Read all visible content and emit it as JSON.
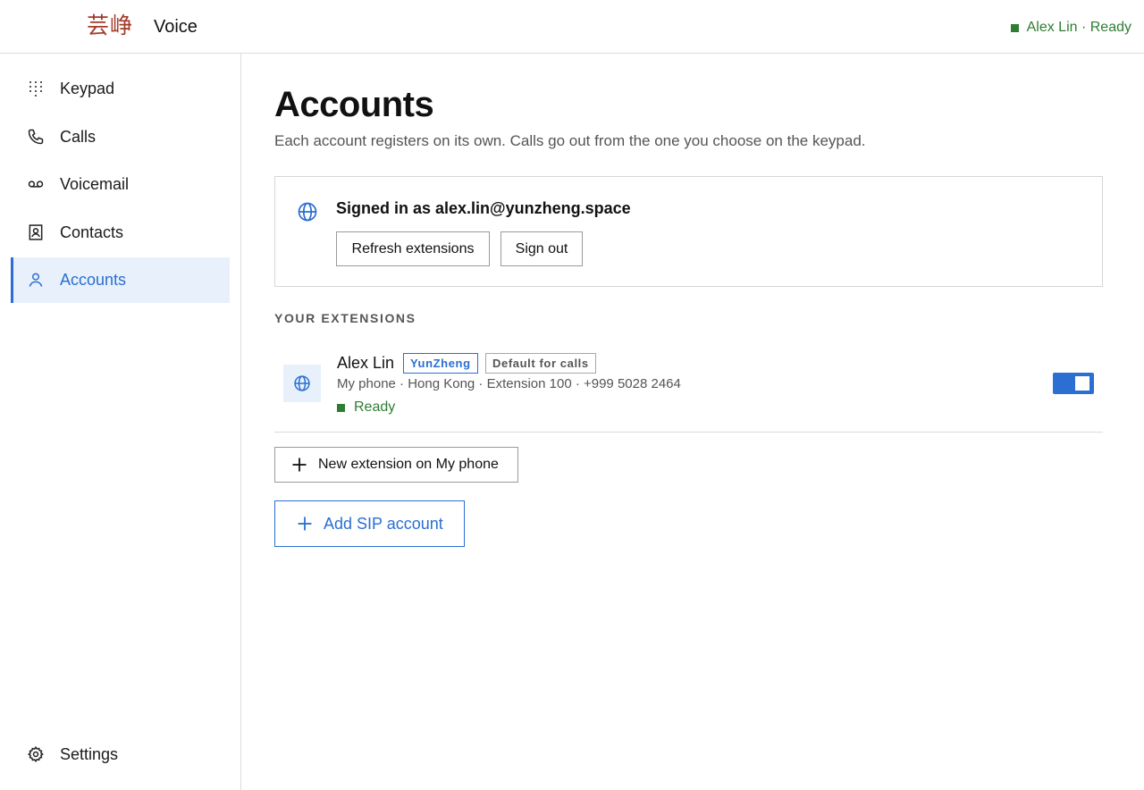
{
  "header": {
    "logo": "芸峥",
    "title": "Voice",
    "status": "Alex Lin · Ready"
  },
  "sidebar": {
    "items": [
      {
        "label": "Keypad",
        "icon": "keypad-icon"
      },
      {
        "label": "Calls",
        "icon": "phone-icon"
      },
      {
        "label": "Voicemail",
        "icon": "voicemail-icon"
      },
      {
        "label": "Contacts",
        "icon": "contacts-icon"
      },
      {
        "label": "Accounts",
        "icon": "person-icon",
        "active": true
      }
    ],
    "settings": {
      "label": "Settings",
      "icon": "gear-icon"
    }
  },
  "main": {
    "title": "Accounts",
    "subtitle": "Each account registers on its own. Calls go out from the one you choose on the keypad.",
    "signin": {
      "text": "Signed in as alex.lin@yunzheng.space",
      "refresh_label": "Refresh extensions",
      "signout_label": "Sign out"
    },
    "section_label": "YOUR EXTENSIONS",
    "extension": {
      "name": "Alex Lin",
      "brand_badge": "YunZheng",
      "default_badge": "Default for calls",
      "meta": "My phone · Hong Kong · Extension 100 · +999 5028 2464",
      "status": "Ready",
      "enabled": true
    },
    "new_extension_label": "New extension on My phone",
    "add_sip_label": "Add SIP account"
  },
  "colors": {
    "accent": "#2a6fd1",
    "ready": "#2e7d32",
    "logo": "#a33a2a"
  }
}
